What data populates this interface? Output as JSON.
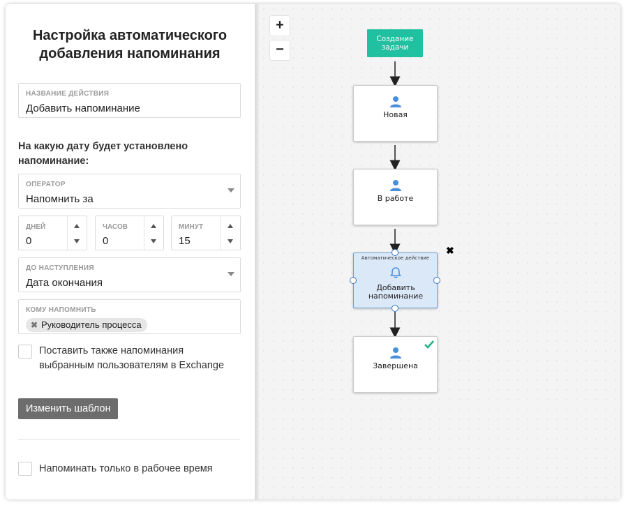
{
  "sidebar": {
    "title": "Настройка автоматического добавления напоминания",
    "action_name": {
      "label": "НАЗВАНИЕ ДЕЙСТВИЯ",
      "value": "Добавить напоминание"
    },
    "question": "На какую дату будет установлено напоминание:",
    "operator": {
      "label": "ОПЕРАТОР",
      "value": "Напомнить за"
    },
    "days": {
      "label": "ДНЕЙ",
      "value": "0"
    },
    "hours": {
      "label": "ЧАСОВ",
      "value": "0"
    },
    "minutes": {
      "label": "МИНУТ",
      "value": "15"
    },
    "before": {
      "label": "ДО НАСТУПЛЕНИЯ",
      "value": "Дата окончания"
    },
    "whom": {
      "label": "КОМУ НАПОМНИТЬ",
      "chip": "Руководитель процесса"
    },
    "exchange_checkbox": {
      "label": "Поставить также напоминания выбранным пользователям в Exchange",
      "checked": false
    },
    "change_template_button": "Изменить шаблон",
    "worktime_checkbox": {
      "label": "Напоминать только в рабочее время",
      "checked": false
    }
  },
  "canvas": {
    "zoom_in": "+",
    "zoom_out": "−",
    "start_node": "Создание задачи",
    "nodes": [
      {
        "name": "Новая",
        "icon": "user-icon"
      },
      {
        "name": "В работе",
        "icon": "user-icon"
      }
    ],
    "action_node": {
      "subtitle": "Автоматическое действие",
      "name": "Добавить напоминание",
      "icon": "bell-icon",
      "selected": true
    },
    "final_node": {
      "name": "Завершена",
      "icon": "user-icon",
      "badge": "check-icon"
    },
    "delete_icon": "✖"
  },
  "colors": {
    "start_node": "#21c0a0",
    "action_bg": "#dbe8f8",
    "action_border": "#6fa3dc",
    "user_icon": "#4a90d9",
    "check": "#21b08a",
    "button": "#6d6d6d"
  }
}
